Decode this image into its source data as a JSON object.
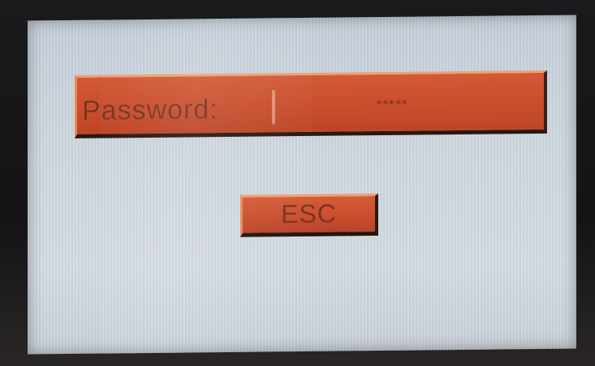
{
  "login": {
    "password_label": "Password:",
    "password_value": "*****",
    "esc_label": "ESC"
  },
  "colors": {
    "screen_background": "#cdd5dd",
    "field_fill": "#c94f2e",
    "text": "#7a3422",
    "bezel": "#1b1a1c"
  }
}
